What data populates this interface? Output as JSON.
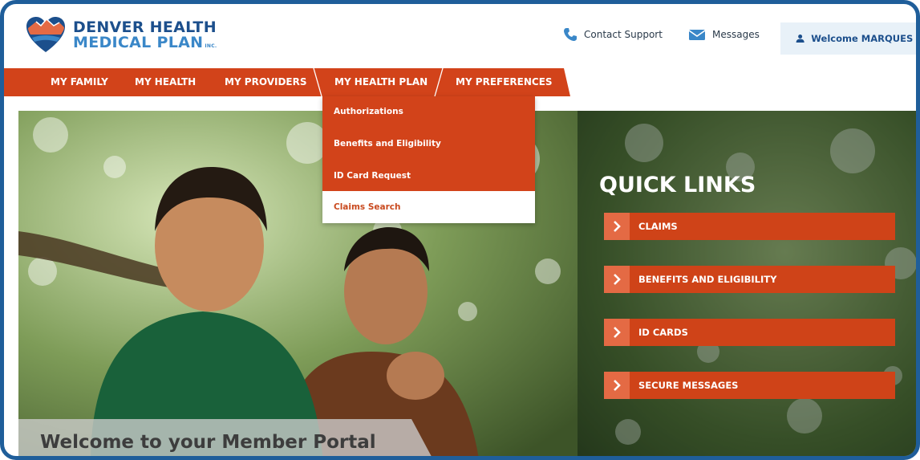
{
  "header": {
    "logo": {
      "line1": "DENVER HEALTH",
      "line2": "MEDICAL PLAN",
      "suffix": "INC."
    },
    "contact_support": "Contact Support",
    "messages": "Messages",
    "welcome": "Welcome MARQUES"
  },
  "nav": {
    "items": [
      {
        "label": "MY FAMILY"
      },
      {
        "label": "MY HEALTH"
      },
      {
        "label": "MY PROVIDERS"
      },
      {
        "label": "MY HEALTH PLAN"
      },
      {
        "label": "MY PREFERENCES"
      }
    ],
    "active_index": 3
  },
  "dropdown": {
    "items": [
      {
        "label": "Authorizations"
      },
      {
        "label": "Benefits and Eligibility"
      },
      {
        "label": "ID Card Request"
      },
      {
        "label": "Claims Search"
      }
    ],
    "highlighted_index": 3
  },
  "quick_links": {
    "title": "QUICK LINKS",
    "items": [
      {
        "label": "CLAIMS"
      },
      {
        "label": "BENEFITS AND ELIGIBILITY"
      },
      {
        "label": "ID CARDS"
      },
      {
        "label": "SECURE MESSAGES"
      }
    ]
  },
  "hero": {
    "welcome": "Welcome to your Member Portal"
  },
  "colors": {
    "brand_navy": "#1c4f8c",
    "brand_blue": "#3a87c8",
    "accent_orange": "#d2431a",
    "quick_link_arrow": "#e46a44",
    "frame_border": "#1f5e9a"
  },
  "icons": {
    "logo": "heart-mountain-logo",
    "contact": "phone-icon",
    "messages": "envelope-icon",
    "user": "user-icon",
    "menu_chevron": "chevron-down-icon",
    "quick_link": "chevron-right-icon"
  }
}
